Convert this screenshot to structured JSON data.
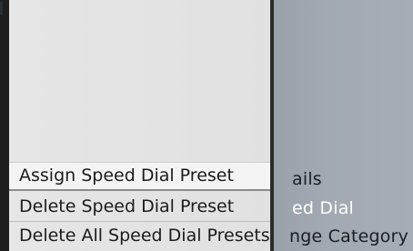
{
  "popup_menu": {
    "items": [
      {
        "label": "Assign Speed Dial Preset",
        "selected": true
      },
      {
        "label": "Delete Speed Dial Preset",
        "selected": false
      },
      {
        "label": "Delete All Speed Dial Presets",
        "selected": false
      }
    ]
  },
  "background_menu": {
    "items": [
      {
        "label": "ails"
      },
      {
        "label": "ed Dial",
        "selected": true
      },
      {
        "label": "nge Category"
      }
    ]
  },
  "colors": {
    "popup_background": "#e4e4e4",
    "background_screen": "#a2a9b2",
    "selected_bg_text": "#ffffff"
  }
}
